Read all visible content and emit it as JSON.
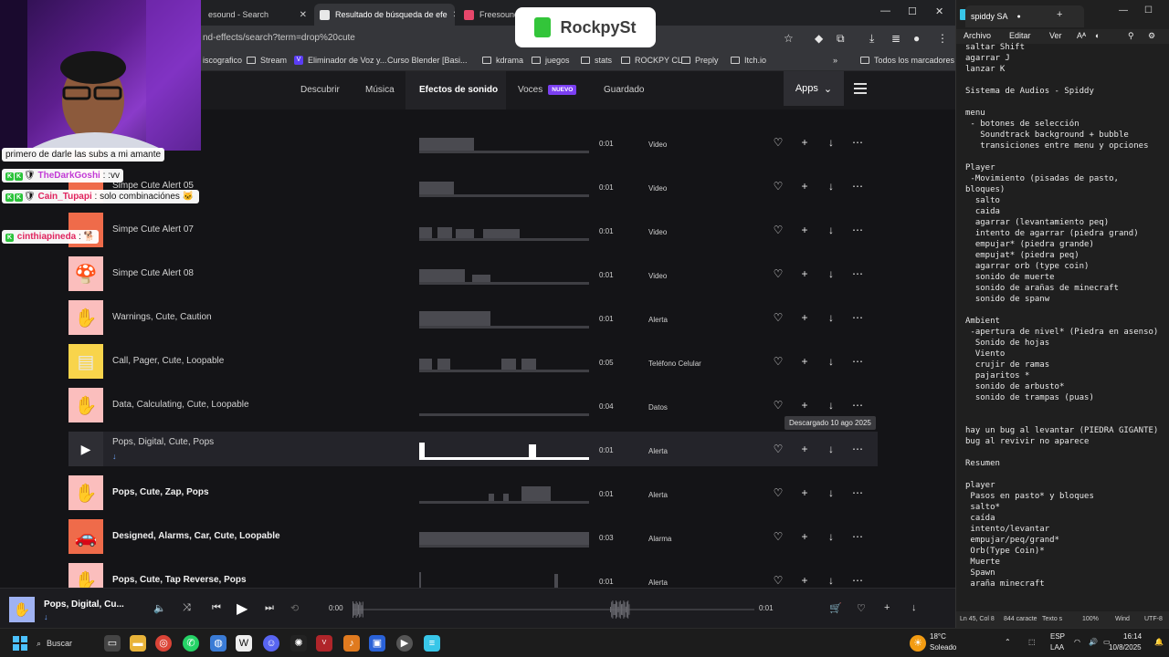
{
  "browser": {
    "tabs": [
      {
        "label": "esound - Search",
        "color": "#2b2b2b"
      },
      {
        "label": "Resultado de búsqueda de efe",
        "color": "#e8e8e8"
      },
      {
        "label": "Freesound",
        "color": "#e7476b"
      }
    ],
    "url": "nd-effects/search?term=drop%20cute",
    "bookmarks": [
      "iscografico",
      "Stream",
      "Eliminador de Voz y...",
      "Curso Blender [Basi...",
      "kdrama",
      "juegos",
      "stats",
      "ROCKPY CL",
      "Preply",
      "Itch.io",
      "Todos los marcadores"
    ]
  },
  "nav": {
    "links": [
      "Descubrir",
      "Música",
      "Efectos de sonido",
      "Voces",
      "Guardado"
    ],
    "new_badge": "NUEVO",
    "apps": "Apps"
  },
  "rows": [
    {
      "name": "",
      "duration": "0:01",
      "category": "Video",
      "thumb": "#ef6b4a",
      "icon": "",
      "bold": false
    },
    {
      "name": "Simpe Cute Alert 05",
      "duration": "0:01",
      "category": "Video",
      "thumb": "#ef6b4a",
      "icon": "",
      "bold": false
    },
    {
      "name": "Simpe Cute Alert 07",
      "duration": "0:01",
      "category": "Video",
      "thumb": "#ef6b4a",
      "icon": "",
      "bold": false
    },
    {
      "name": "Simpe Cute Alert 08",
      "duration": "0:01",
      "category": "Video",
      "thumb": "#fbbebd",
      "icon": "mushroom-icon",
      "bold": false
    },
    {
      "name": "Warnings, Cute, Caution",
      "duration": "0:01",
      "category": "Alerta",
      "thumb": "#fbbebd",
      "icon": "hand-icon",
      "bold": false
    },
    {
      "name": "Call, Pager, Cute, Loopable",
      "duration": "0:05",
      "category": "Teléfono Celular",
      "thumb": "#f8d44b",
      "icon": "pager-icon",
      "bold": false
    },
    {
      "name": "Data, Calculating, Cute, Loopable",
      "duration": "0:04",
      "category": "Datos",
      "thumb": "#fbbebd",
      "icon": "hand-icon",
      "bold": false
    },
    {
      "name": "Pops, Digital, Cute, Pops",
      "duration": "0:01",
      "category": "Alerta",
      "thumb": "#2e2e34",
      "icon": "play-icon",
      "bold": false,
      "selected": true
    },
    {
      "name": "Pops, Cute, Zap, Pops",
      "duration": "0:01",
      "category": "Alerta",
      "thumb": "#fbbebd",
      "icon": "hand-icon",
      "bold": true
    },
    {
      "name": "Designed, Alarms, Car, Cute, Loopable",
      "duration": "0:03",
      "category": "Alarma",
      "thumb": "#ef6b4a",
      "icon": "car-icon",
      "bold": true
    },
    {
      "name": "Pops, Cute, Tap Reverse, Pops",
      "duration": "0:01",
      "category": "Alerta",
      "thumb": "#fbbebd",
      "icon": "hand-icon",
      "bold": true
    }
  ],
  "tooltip": "Descargado 10 ago 2025",
  "player": {
    "title": "Pops, Digital, Cu...",
    "time_current": "0:00",
    "time_total": "0:01",
    "progress": 0
  },
  "logo": {
    "text": "RockpySt"
  },
  "chat": [
    {
      "user": "",
      "text": "primero de darle las subs a mi amante"
    },
    {
      "user": "TheDarkGoshi",
      "text": ": :vv"
    },
    {
      "user": "Cain_Tupapi",
      "text": ": solo combinaciónes"
    },
    {
      "user": "cinthiapineda",
      "text": ":"
    }
  ],
  "notepad": {
    "tab_title": "spiddy SA",
    "menu": [
      "Archivo",
      "Editar",
      "Ver"
    ],
    "text": "saltar Shift\nagarrar J\nlanzar K\n\nSistema de Audios - Spiddy\n\nmenu\n - botones de selección\n   Soundtrack background + bubble\n   transiciones entre menu y opciones\n\nPlayer\n -Movimiento (pisadas de pasto,\nbloques)\n  salto\n  caida\n  agarrar (levantamiento peq)\n  intento de agarrar (piedra grand)\n  empujar* (piedra grande)\n  empujat* (piedra peq)\n  agarrar orb (type coin)\n  sonido de muerte\n  sonido de arañas de minecraft\n  sonido de spanw\n\nAmbient\n -apertura de nivel* (Piedra en asenso)\n  Sonido de hojas\n  Viento\n  crujir de ramas\n  pajaritos *\n  sonido de arbusto*\n  sonido de trampas (puas)\n\n\nhay un bug al levantar (PIEDRA GIGANTE)\nbug al revivir no aparece\n\nResumen\n\nplayer\n Pasos en pasto* y bloques\n salto*\n caída\n intento/levantar\n empujar/peq/grand*\n Orb(Type Coin)*\n Muerte\n Spawn\n araña minecraft",
    "status": {
      "pos": "Ln 45, Col 8",
      "chars": "844 caracte",
      "enc_label": "Texto s",
      "zoom": "100%",
      "eol": "Wind",
      "enc": "UTF-8"
    }
  },
  "taskbar": {
    "search": "Buscar",
    "weather_temp": "18°C",
    "weather_text": "Soleado",
    "lang1": "ESP",
    "lang2": "LAA",
    "time": "16:14",
    "date": "10/8/2025"
  }
}
